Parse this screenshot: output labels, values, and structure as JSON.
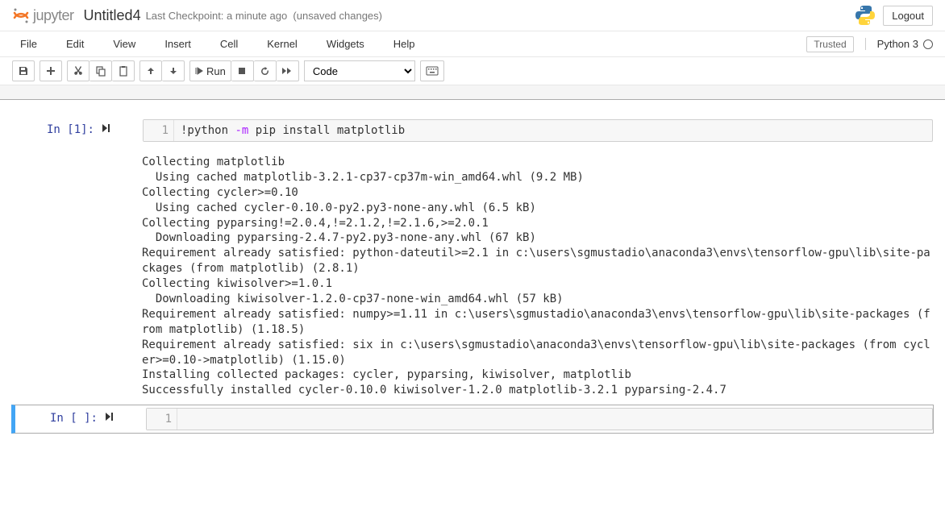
{
  "header": {
    "logo_text": "jupyter",
    "title": "Untitled4",
    "checkpoint": "Last Checkpoint: a minute ago",
    "unsaved": "(unsaved changes)",
    "logout": "Logout"
  },
  "menubar": {
    "items": [
      "File",
      "Edit",
      "View",
      "Insert",
      "Cell",
      "Kernel",
      "Widgets",
      "Help"
    ],
    "trusted": "Trusted",
    "kernel": "Python 3"
  },
  "toolbar": {
    "run_label": "Run",
    "cell_type": "Code"
  },
  "cells": [
    {
      "prompt": "In [1]:",
      "line_no": "1",
      "code_html": "!python <span class='cm-flag'>-m</span> pip install matplotlib",
      "output": "Collecting matplotlib\n  Using cached matplotlib-3.2.1-cp37-cp37m-win_amd64.whl (9.2 MB)\nCollecting cycler>=0.10\n  Using cached cycler-0.10.0-py2.py3-none-any.whl (6.5 kB)\nCollecting pyparsing!=2.0.4,!=2.1.2,!=2.1.6,>=2.0.1\n  Downloading pyparsing-2.4.7-py2.py3-none-any.whl (67 kB)\nRequirement already satisfied: python-dateutil>=2.1 in c:\\users\\sgmustadio\\anaconda3\\envs\\tensorflow-gpu\\lib\\site-packages (from matplotlib) (2.8.1)\nCollecting kiwisolver>=1.0.1\n  Downloading kiwisolver-1.2.0-cp37-none-win_amd64.whl (57 kB)\nRequirement already satisfied: numpy>=1.11 in c:\\users\\sgmustadio\\anaconda3\\envs\\tensorflow-gpu\\lib\\site-packages (from matplotlib) (1.18.5)\nRequirement already satisfied: six in c:\\users\\sgmustadio\\anaconda3\\envs\\tensorflow-gpu\\lib\\site-packages (from cycler>=0.10->matplotlib) (1.15.0)\nInstalling collected packages: cycler, pyparsing, kiwisolver, matplotlib\nSuccessfully installed cycler-0.10.0 kiwisolver-1.2.0 matplotlib-3.2.1 pyparsing-2.4.7"
    },
    {
      "prompt": "In [ ]:",
      "line_no": "1",
      "code_html": "",
      "output": null,
      "selected": true
    }
  ]
}
